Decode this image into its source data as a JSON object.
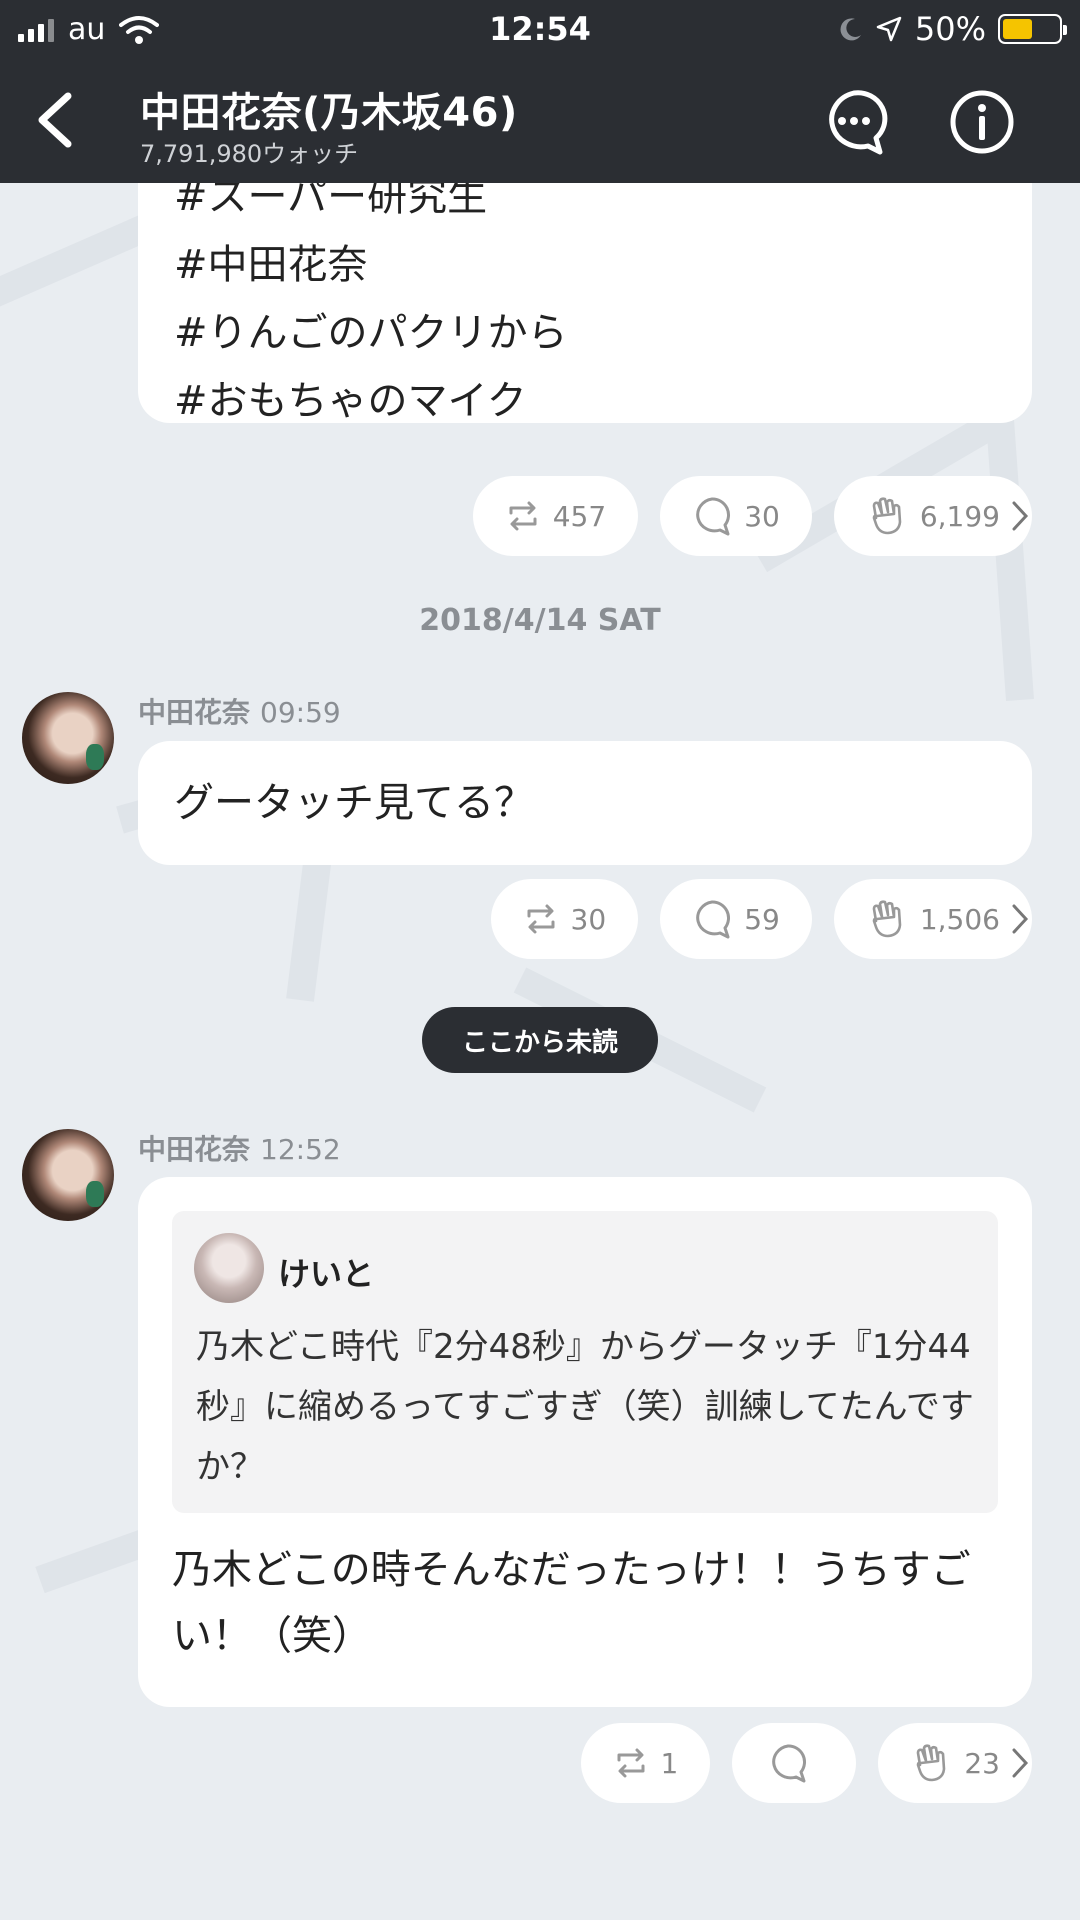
{
  "status_bar": {
    "carrier": "au",
    "time": "12:54",
    "battery": "50%",
    "battery_level": 0.5
  },
  "header": {
    "title": "中田花奈(乃木坂46)",
    "subtitle": "7,791,980ウォッチ"
  },
  "post_prev": {
    "tags": [
      "#スーパー研究生",
      "#中田花奈",
      "#りんごのパクリから",
      "#おもちゃのマイク"
    ],
    "retweets": "457",
    "comments": "30",
    "claps": "6,199"
  },
  "date_separator": "2018/4/14 SAT",
  "post1": {
    "author": "中田花奈",
    "time": "09:59",
    "text": "グータッチ見てる？",
    "retweets": "30",
    "comments": "59",
    "claps": "1,506"
  },
  "unread_label": "ここから未読",
  "post2": {
    "author": "中田花奈",
    "time": "12:52",
    "quote": {
      "name": "けいと",
      "text": "乃木どこ時代『2分48秒』からグータッチ『1分44秒』に縮めるってすごすぎ（笑）訓練してたんですか？"
    },
    "text": "乃木どこの時そんなだったっけ！！うちすごい！（笑）",
    "retweets": "1",
    "comments": "",
    "claps": "23"
  },
  "colors": {
    "header_bg": "#2b2e33",
    "page_bg": "#e9edf1",
    "battery": "#f5c400"
  }
}
